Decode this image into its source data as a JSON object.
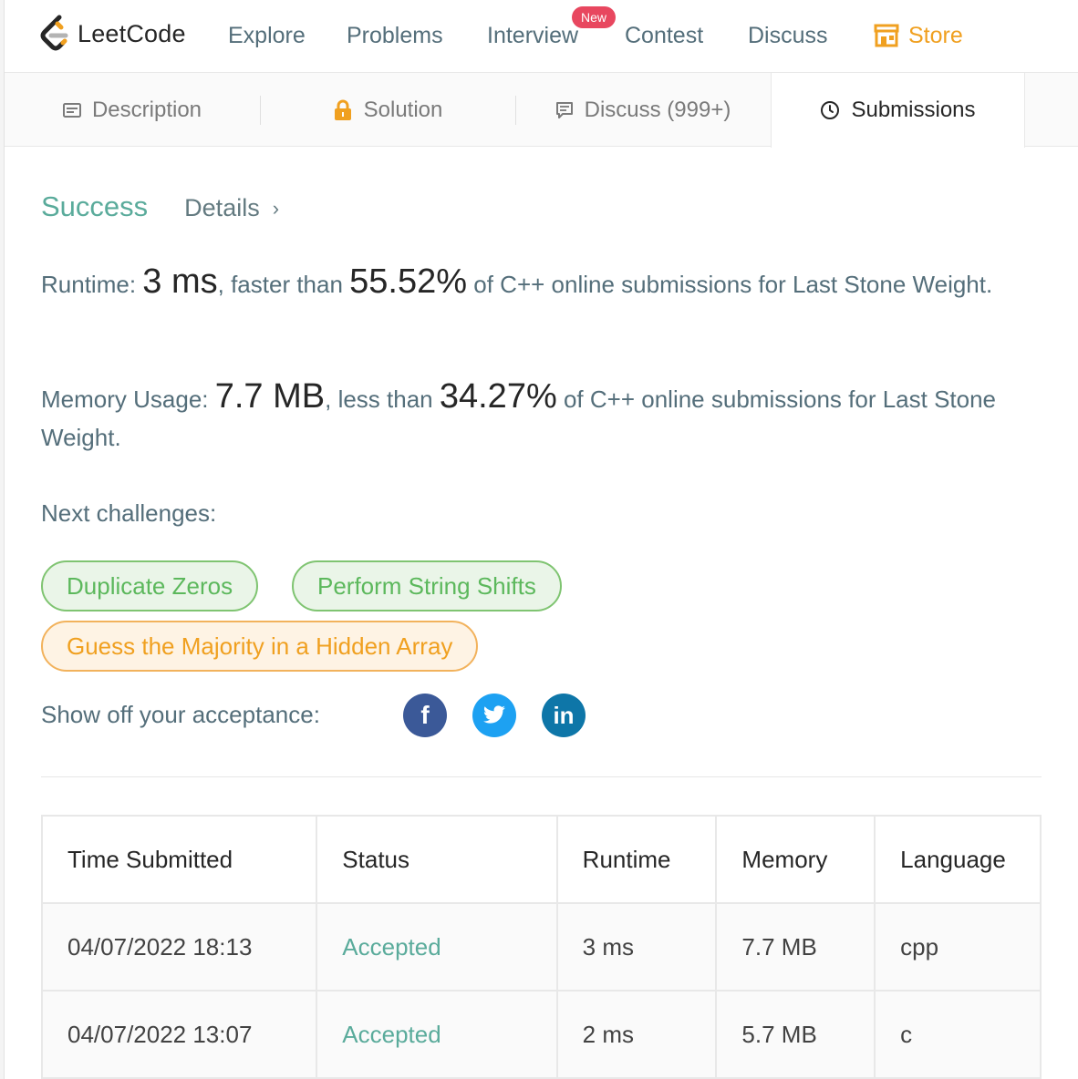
{
  "nav": {
    "logo_text": "LeetCode",
    "items": [
      "Explore",
      "Problems",
      "Interview",
      "Contest",
      "Discuss"
    ],
    "badge_new": "New",
    "store_label": "Store"
  },
  "tabs": [
    {
      "label": "Description",
      "icon": "description-icon"
    },
    {
      "label": "Solution",
      "icon": "lock-icon"
    },
    {
      "label": "Discuss (999+)",
      "icon": "chat-icon"
    },
    {
      "label": "Submissions",
      "icon": "clock-icon",
      "active": true
    }
  ],
  "result": {
    "status": "Success",
    "details_label": "Details",
    "runtime_label": "Runtime: ",
    "runtime_value": "3 ms",
    "runtime_mid": ", faster than ",
    "runtime_percent": "55.52%",
    "runtime_tail": " of C++ online submissions for Last Stone Weight.",
    "memory_label": "Memory Usage: ",
    "memory_value": "7.7 MB",
    "memory_mid": ", less than ",
    "memory_percent": "34.27%",
    "memory_tail": " of C++ online submissions for Last Stone Weight."
  },
  "next_challenges": {
    "label": "Next challenges:",
    "items": [
      {
        "label": "Duplicate Zeros",
        "difficulty": "easy"
      },
      {
        "label": "Perform String Shifts",
        "difficulty": "easy"
      },
      {
        "label": "Guess the Majority in a Hidden Array",
        "difficulty": "medium"
      }
    ]
  },
  "share": {
    "label": "Show off your acceptance:",
    "facebook_glyph": "f",
    "linkedin_glyph": "in"
  },
  "colors": {
    "success": "#5aab9b",
    "easy": "#5cb85c",
    "medium": "#f0a020",
    "store": "#f0a020",
    "badge": "#e8475f"
  },
  "submissions": {
    "headers": [
      "Time Submitted",
      "Status",
      "Runtime",
      "Memory",
      "Language"
    ],
    "rows": [
      [
        "04/07/2022 18:13",
        "Accepted",
        "3 ms",
        "7.7 MB",
        "cpp"
      ],
      [
        "04/07/2022 13:07",
        "Accepted",
        "2 ms",
        "5.7 MB",
        "c"
      ]
    ]
  }
}
